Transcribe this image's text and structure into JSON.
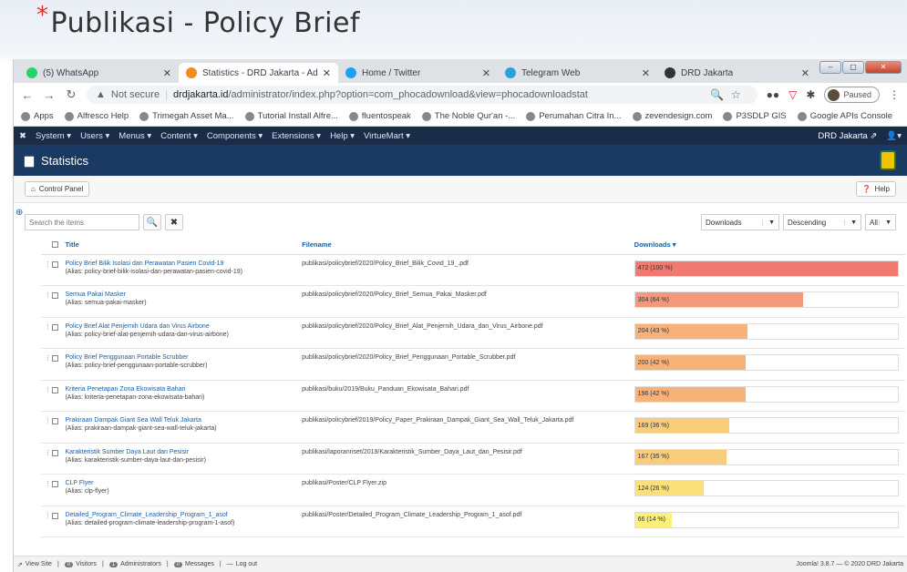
{
  "slide": {
    "title": "Publikasi - Policy Brief",
    "star": "*"
  },
  "tabs": [
    {
      "label": "(5) WhatsApp",
      "icon": "whatsapp-icon",
      "color": "#25d366"
    },
    {
      "label": "Statistics - DRD Jakarta - Admir",
      "icon": "joomla-icon",
      "color": "#f48b20"
    },
    {
      "label": "Home / Twitter",
      "icon": "twitter-icon",
      "color": "#1da1f2"
    },
    {
      "label": "Telegram Web",
      "icon": "telegram-icon",
      "color": "#2aa1da"
    },
    {
      "label": "DRD Jakarta",
      "icon": "home-icon",
      "color": "#333333"
    }
  ],
  "address": {
    "secure": "Not secure",
    "domain": "drdjakarta.id",
    "path": "/administrator/index.php?option=com_phocadownload&view=phocadownloadstat",
    "paused": "Paused"
  },
  "bookmarks": [
    "Apps",
    "Alfresco Help",
    "Trimegah Asset Ma...",
    "Tutorial Install Alfre...",
    "fluentospeak",
    "The Noble Qur'an -...",
    "Perumahan Citra In...",
    "zevendesign.com",
    "P3SDLP GIS",
    "Google APIs Console"
  ],
  "admin_menu": [
    "System ▾",
    "Users ▾",
    "Menus ▾",
    "Content ▾",
    "Components ▾",
    "Extensions ▾",
    "Help ▾",
    "VirtueMart ▾"
  ],
  "admin_site": "DRD Jakarta ⇗",
  "page_title": "Statistics",
  "toolbar": {
    "control_panel": "Control Panel",
    "help": "Help"
  },
  "filters": {
    "search_placeholder": "Search the items",
    "sort_field": "Downloads",
    "sort_dir": "Descending",
    "limit": "All"
  },
  "columns": {
    "title": "Title",
    "filename": "Filename",
    "downloads": "Downloads ▾"
  },
  "rows": [
    {
      "title": "Policy Brief Bilik Isolasi dan Perawatan Pasien Covid-19",
      "alias": "(Alias: policy-brief-bilik-isolasi-dan-perawatan-pasien-covid-19)",
      "file": "publikasi/policybrief/2020/Policy_Brief_Bilik_Covid_19_.pdf",
      "downloads": "472 (100 %)",
      "pct": 100,
      "color": "#f07a70"
    },
    {
      "title": "Semua Pakai Masker",
      "alias": "(Alias: semua-pakai-masker)",
      "file": "publikasi/policybrief/2020/Policy_Brief_Semua_Pakai_Masker.pdf",
      "downloads": "304 (64 %)",
      "pct": 64,
      "color": "#f5987a"
    },
    {
      "title": "Policy Brief Alat Penjernih Udara dan Virus Airbone",
      "alias": "(Alias: policy-brief-alat-penjernih-udara-dan-virus-airbone)",
      "file": "publikasi/policybrief/2020/Policy_Brief_Alat_Penjernih_Udara_dan_Virus_Airbone.pdf",
      "downloads": "204 (43 %)",
      "pct": 43,
      "color": "#f7b27a"
    },
    {
      "title": "Policy Brief Penggunaan Portable Scrubber",
      "alias": "(Alias: policy-brief-penggunaan-portable-scrubber)",
      "file": "publikasi/policybrief/2020/Policy_Brief_Penggunaan_Portable_Scrubber.pdf",
      "downloads": "200 (42 %)",
      "pct": 42,
      "color": "#f7b27a"
    },
    {
      "title": "Kriteria Penetapan Zona Ekowisata Bahari",
      "alias": "(Alias: kriteria-penetapan-zona-ekowisata-bahari)",
      "file": "publikasi/buku/2019/Buku_Panduan_Ekowisata_Bahari.pdf",
      "downloads": "196 (42 %)",
      "pct": 42,
      "color": "#f7b27a"
    },
    {
      "title": "Prakiraan Dampak Giant Sea Wall Teluk Jakarta",
      "alias": "(Alias: prakiraan-dampak-giant-sea-wall-teluk-jakarta)",
      "file": "publikasi/policybrief/2019/Policy_Paper_Prakiraan_Dampak_Giant_Sea_Wall_Teluk_Jakarta.pdf",
      "downloads": "169 (36 %)",
      "pct": 36,
      "color": "#f9cc7a"
    },
    {
      "title": "Karakteristik Sumber Daya Laut dan Pesisir",
      "alias": "(Alias: karakteristik-sumber-daya-laut-dan-pesisir)",
      "file": "publikasi/laporanriset/2019/Karakteristik_Sumber_Daya_Laut_dan_Pesisir.pdf",
      "downloads": "167 (35 %)",
      "pct": 35,
      "color": "#f9cc7a"
    },
    {
      "title": "CLP Flyer",
      "alias": "(Alias: clp-flyer)",
      "file": "publikasi/Poster/CLP Flyer.zip",
      "downloads": "124 (26 %)",
      "pct": 26,
      "color": "#fbe07a"
    },
    {
      "title": "Detailed_Program_Climate_Leadership_Program_1_asof",
      "alias": "(Alias: detailed-program-climate-leadership-program-1-asof)",
      "file": "publikasi/Poster/Detailed_Program_Climate_Leadership_Program_1_asof.pdf",
      "downloads": "66 (14 %)",
      "pct": 14,
      "color": "#fdf07a"
    }
  ],
  "statusbar": {
    "view_site": "View Site",
    "visitors": "Visitors",
    "visitors_count": "0",
    "administrators": "Administrators",
    "admins_count": "1",
    "messages": "Messages",
    "messages_count": "0",
    "logout": "Log out",
    "version": "Joomla! 3.8.7 — © 2020 DRD Jakarta"
  }
}
